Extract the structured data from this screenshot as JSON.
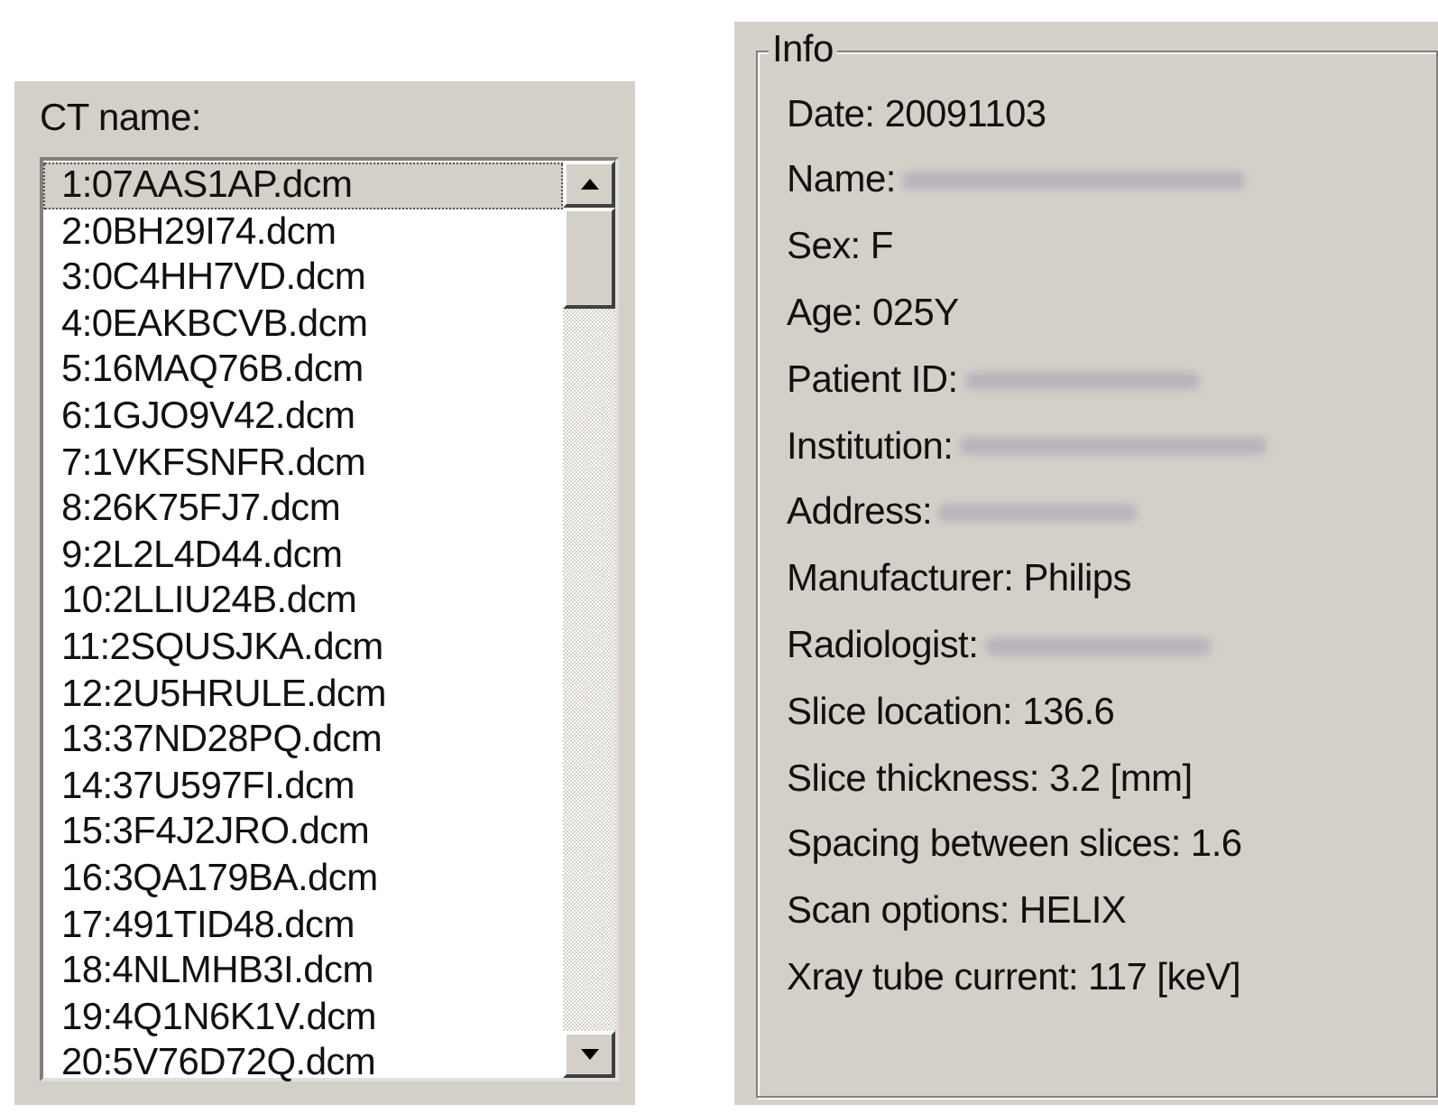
{
  "ct_panel": {
    "label": "CT name:",
    "files": [
      {
        "label": "1:07AAS1AP.dcm",
        "selected": true
      },
      {
        "label": "2:0BH29I74.dcm",
        "selected": false
      },
      {
        "label": "3:0C4HH7VD.dcm",
        "selected": false
      },
      {
        "label": "4:0EAKBCVB.dcm",
        "selected": false
      },
      {
        "label": "5:16MAQ76B.dcm",
        "selected": false
      },
      {
        "label": "6:1GJO9V42.dcm",
        "selected": false
      },
      {
        "label": "7:1VKFSNFR.dcm",
        "selected": false
      },
      {
        "label": "8:26K75FJ7.dcm",
        "selected": false
      },
      {
        "label": "9:2L2L4D44.dcm",
        "selected": false
      },
      {
        "label": "10:2LLIU24B.dcm",
        "selected": false
      },
      {
        "label": "11:2SQUSJKA.dcm",
        "selected": false
      },
      {
        "label": "12:2U5HRULE.dcm",
        "selected": false
      },
      {
        "label": "13:37ND28PQ.dcm",
        "selected": false
      },
      {
        "label": "14:37U597FI.dcm",
        "selected": false
      },
      {
        "label": "15:3F4J2JRO.dcm",
        "selected": false
      },
      {
        "label": "16:3QA179BA.dcm",
        "selected": false
      },
      {
        "label": "17:491TID48.dcm",
        "selected": false
      },
      {
        "label": "18:4NLMHB3I.dcm",
        "selected": false
      },
      {
        "label": "19:4Q1N6K1V.dcm",
        "selected": false
      },
      {
        "label": "20:5V76D72Q.dcm",
        "selected": false
      }
    ]
  },
  "info": {
    "title": "Info",
    "fields": [
      {
        "text": "Date: 20091103",
        "redacted": false
      },
      {
        "text": "Name:",
        "redacted": true
      },
      {
        "text": "Sex: F",
        "redacted": false
      },
      {
        "text": "Age: 025Y",
        "redacted": false
      },
      {
        "text": "Patient ID:",
        "redacted": true
      },
      {
        "text": "Institution:",
        "redacted": true
      },
      {
        "text": "Address:",
        "redacted": true
      },
      {
        "text": "Manufacturer: Philips",
        "redacted": false
      },
      {
        "text": "Radiologist:",
        "redacted": true
      },
      {
        "text": "Slice location: 136.6",
        "redacted": false
      },
      {
        "text": "Slice thickness: 3.2 [mm]",
        "redacted": false
      },
      {
        "text": "Spacing between slices: 1.6",
        "redacted": false
      },
      {
        "text": "Scan options: HELIX",
        "redacted": false
      },
      {
        "text": "Xray tube current: 117 [keV]",
        "redacted": false
      }
    ]
  }
}
